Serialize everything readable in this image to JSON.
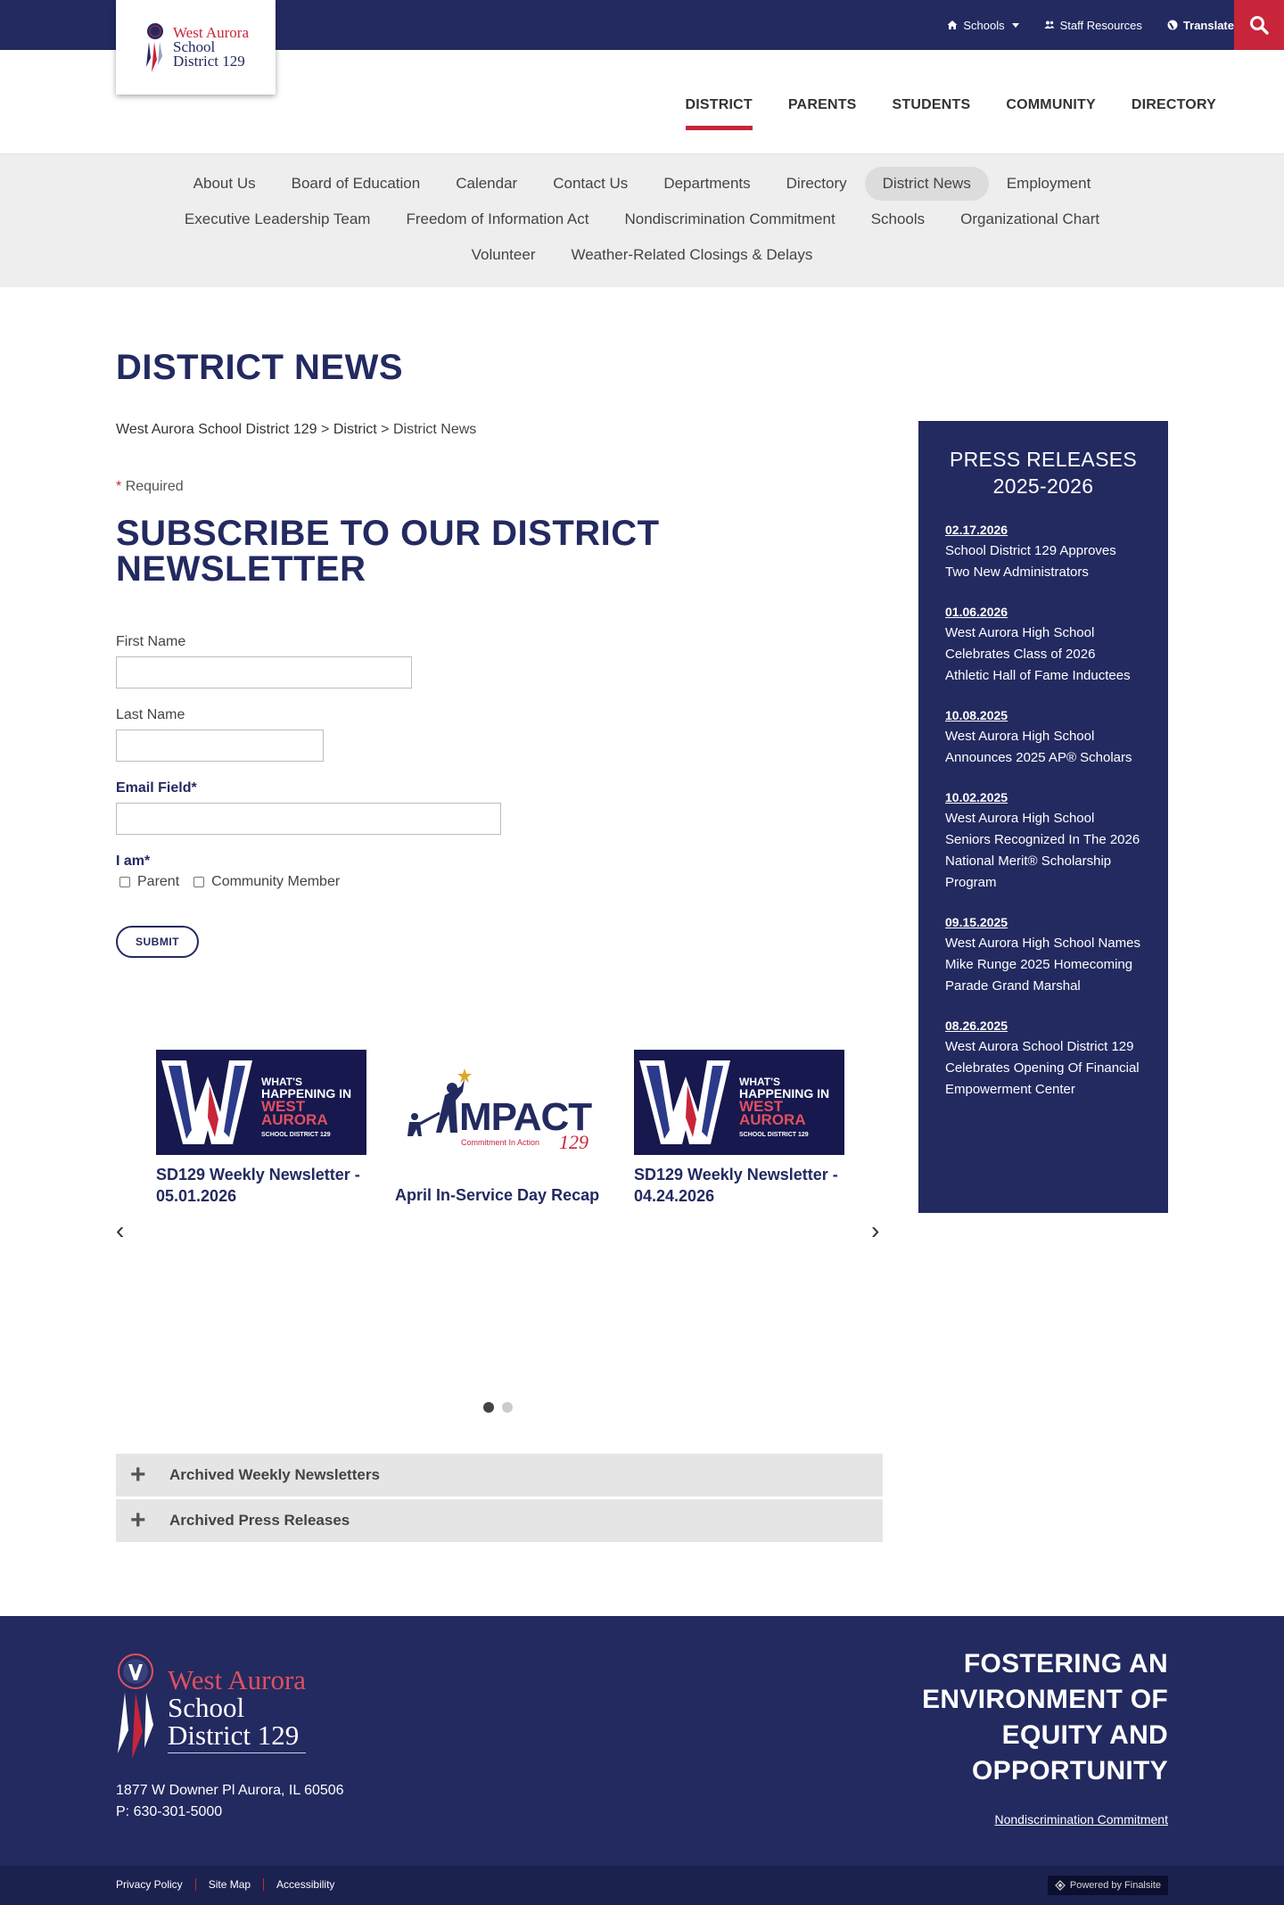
{
  "utility": {
    "schools": "Schools",
    "staff": "Staff Resources",
    "translate": "Translate"
  },
  "logo": {
    "line1": "West Aurora",
    "line2": "School",
    "line3": "District 129"
  },
  "mainnav": [
    "DISTRICT",
    "PARENTS",
    "STUDENTS",
    "COMMUNITY",
    "DIRECTORY"
  ],
  "subnav": {
    "row1": [
      "About Us",
      "Board of Education",
      "Calendar",
      "Contact Us",
      "Departments",
      "Directory",
      "District News",
      "Employment"
    ],
    "row2": [
      "Executive Leadership Team",
      "Freedom of Information Act",
      "Nondiscrimination Commitment",
      "Schools",
      "Organizational Chart"
    ],
    "row3": [
      "Volunteer",
      "Weather-Related Closings & Delays"
    ]
  },
  "page_title": "DISTRICT NEWS",
  "breadcrumb": {
    "home": "West Aurora School District 129",
    "section": "District",
    "current": "District News",
    "sep": ">"
  },
  "form": {
    "required_note": "Required",
    "title": "SUBSCRIBE TO OUR DISTRICT NEWSLETTER",
    "first_name_label": "First Name",
    "last_name_label": "Last Name",
    "email_label": "Email Field*",
    "iam_label": "I am*",
    "opt_parent": "Parent",
    "opt_community": "Community Member",
    "submit": "SUBMIT"
  },
  "carousel": {
    "prev": "‹",
    "next": "›",
    "cards": [
      {
        "title": "SD129 Weekly Newsletter - 05.01.2026",
        "badge_top": "WHAT'S",
        "badge_mid": "HAPPENING IN",
        "badge_main": "WEST AURORA",
        "badge_sub": "SCHOOL DISTRICT 129"
      },
      {
        "title": "April In-Service Day Recap",
        "impact": "MPACT",
        "impact_tag": "Commitment In Action",
        "impact_num": "129"
      },
      {
        "title": "SD129 Weekly Newsletter - 04.24.2026",
        "badge_top": "WHAT'S",
        "badge_mid": "HAPPENING IN",
        "badge_main": "WEST AURORA",
        "badge_sub": "SCHOOL DISTRICT 129"
      }
    ]
  },
  "accordions": [
    "Archived Weekly Newsletters",
    "Archived Press Releases"
  ],
  "sidebar": {
    "title_line1": "PRESS RELEASES",
    "title_line2": "2025-2026",
    "items": [
      {
        "date": "02.17.2026",
        "text": "School District 129 Approves Two New Administrators"
      },
      {
        "date": "01.06.2026",
        "text": "West Aurora High School Celebrates Class of 2026 Athletic Hall of Fame Inductees"
      },
      {
        "date": "10.08.2025",
        "text": "West Aurora High School Announces 2025 AP® Scholars"
      },
      {
        "date": "10.02.2025",
        "text": "West Aurora High School Seniors Recognized In The 2026 National Merit® Scholarship Program"
      },
      {
        "date": "09.15.2025",
        "text": "West Aurora High School Names Mike Runge 2025 Homecoming Parade Grand Marshal"
      },
      {
        "date": "08.26.2025",
        "text": "West Aurora School District 129 Celebrates Opening Of Financial Empowerment Center"
      }
    ]
  },
  "footer": {
    "address": "1877 W Downer Pl Aurora, IL 60506",
    "phone": "P: 630-301-5000",
    "tagline": "FOSTERING AN ENVIRONMENT OF EQUITY AND OPPORTUNITY",
    "nondiscrimination": "Nondiscrimination Commitment",
    "links": [
      "Privacy Policy",
      "Site Map",
      "Accessibility"
    ],
    "powered": "Powered by Finalsite"
  },
  "colors": {
    "navy": "#232a60",
    "red": "#c8253a",
    "gray_nav": "#eeeeee"
  }
}
